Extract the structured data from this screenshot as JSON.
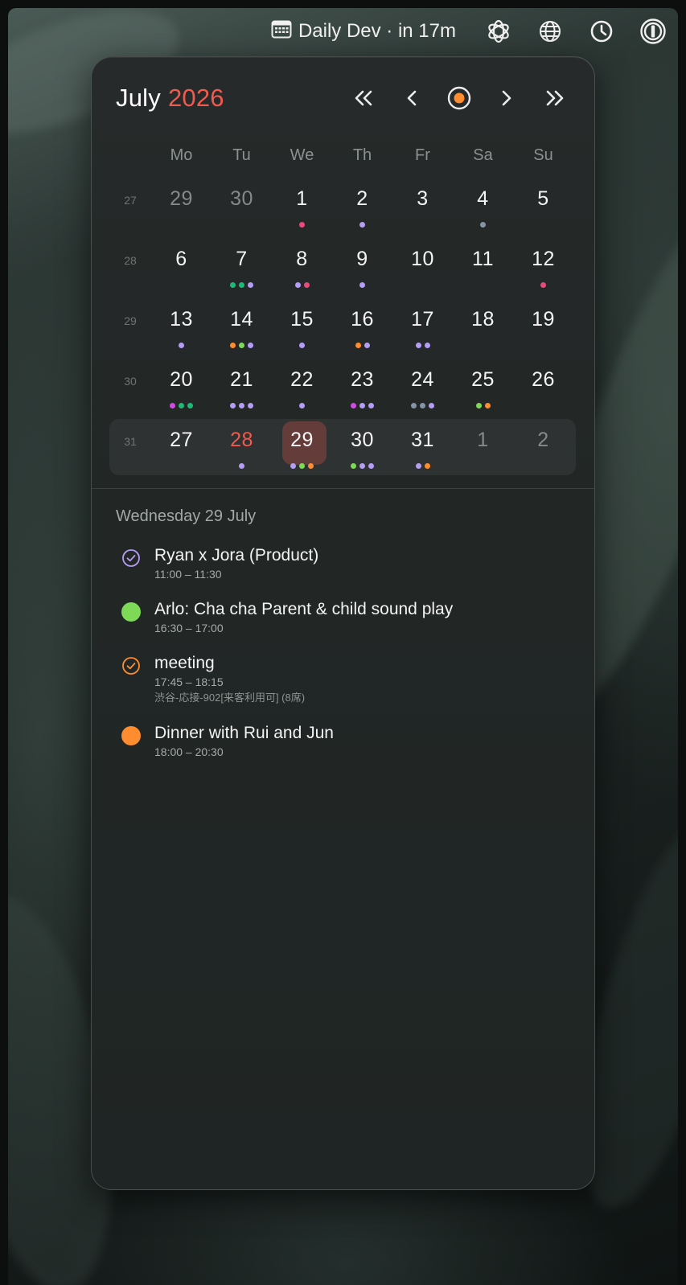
{
  "menubar": {
    "event_label": "Daily Dev · in 17m",
    "icons": [
      "calendar-icon",
      "openai-icon",
      "globe-icon",
      "clock-icon",
      "password-manager-icon"
    ]
  },
  "header": {
    "month": "July",
    "year": "2026",
    "nav": [
      "previous-year",
      "previous-month",
      "today",
      "next-month",
      "next-year"
    ]
  },
  "colors": {
    "accent_red": "#ef5b4f",
    "purple": "#b49cf7",
    "green": "#7ed957",
    "orange": "#ff8c2e",
    "pink": "#e84a7a",
    "teal": "#1fb877",
    "magenta": "#d548e8",
    "slate": "#8493a8"
  },
  "calendar": {
    "weekdays": [
      "Mo",
      "Tu",
      "We",
      "Th",
      "Fr",
      "Sa",
      "Su"
    ],
    "weeks": [
      {
        "week": "27",
        "days": [
          {
            "d": "29",
            "muted": true,
            "dots": []
          },
          {
            "d": "30",
            "muted": true,
            "dots": []
          },
          {
            "d": "1",
            "dots": [
              "pink"
            ]
          },
          {
            "d": "2",
            "dots": [
              "purple"
            ]
          },
          {
            "d": "3",
            "dots": []
          },
          {
            "d": "4",
            "dots": [
              "slate"
            ]
          },
          {
            "d": "5",
            "dots": []
          }
        ]
      },
      {
        "week": "28",
        "days": [
          {
            "d": "6",
            "dots": []
          },
          {
            "d": "7",
            "dots": [
              "teal",
              "teal",
              "purple"
            ]
          },
          {
            "d": "8",
            "dots": [
              "purple",
              "pink"
            ]
          },
          {
            "d": "9",
            "dots": [
              "purple"
            ]
          },
          {
            "d": "10",
            "dots": []
          },
          {
            "d": "11",
            "dots": []
          },
          {
            "d": "12",
            "dots": [
              "pink"
            ]
          }
        ]
      },
      {
        "week": "29",
        "days": [
          {
            "d": "13",
            "dots": [
              "purple"
            ]
          },
          {
            "d": "14",
            "dots": [
              "orange",
              "green",
              "purple"
            ]
          },
          {
            "d": "15",
            "dots": [
              "purple"
            ]
          },
          {
            "d": "16",
            "dots": [
              "orange",
              "purple"
            ]
          },
          {
            "d": "17",
            "dots": [
              "purple",
              "purple"
            ]
          },
          {
            "d": "18",
            "dots": []
          },
          {
            "d": "19",
            "dots": []
          }
        ]
      },
      {
        "week": "30",
        "days": [
          {
            "d": "20",
            "dots": [
              "magenta",
              "teal",
              "teal"
            ]
          },
          {
            "d": "21",
            "dots": [
              "purple",
              "purple",
              "purple"
            ]
          },
          {
            "d": "22",
            "dots": [
              "purple"
            ]
          },
          {
            "d": "23",
            "dots": [
              "magenta",
              "purple",
              "purple"
            ]
          },
          {
            "d": "24",
            "dots": [
              "slate",
              "slate",
              "purple"
            ]
          },
          {
            "d": "25",
            "dots": [
              "green",
              "orange"
            ]
          },
          {
            "d": "26",
            "dots": []
          }
        ]
      },
      {
        "week": "31",
        "current": true,
        "days": [
          {
            "d": "27",
            "dots": []
          },
          {
            "d": "28",
            "today": true,
            "dots": [
              "purple"
            ]
          },
          {
            "d": "29",
            "selected": true,
            "dots": [
              "purple",
              "green",
              "orange"
            ]
          },
          {
            "d": "30",
            "dots": [
              "green",
              "purple",
              "purple"
            ]
          },
          {
            "d": "31",
            "dots": [
              "purple",
              "orange"
            ]
          },
          {
            "d": "1",
            "muted": true,
            "dots": []
          },
          {
            "d": "2",
            "muted": true,
            "dots": []
          }
        ]
      }
    ]
  },
  "agenda": {
    "heading": "Wednesday 29 July",
    "events": [
      {
        "title": "Ryan x Jora (Product)",
        "time": "11:00 – 11:30",
        "location": "",
        "icon": "check-circle-icon",
        "color": "purple",
        "style": "ring-check"
      },
      {
        "title": "Arlo: Cha cha Parent & child sound play",
        "time": "16:30 – 17:00",
        "location": "",
        "icon": "filled-circle-icon",
        "color": "green",
        "style": "filled"
      },
      {
        "title": "meeting",
        "time": "17:45 – 18:15",
        "location": "渋谷-応接-902[来客利用可] (8席)",
        "icon": "check-circle-icon",
        "color": "orange",
        "style": "ring-check"
      },
      {
        "title": "Dinner with Rui and Jun",
        "time": "18:00 – 20:30",
        "location": "",
        "icon": "filled-circle-icon",
        "color": "orange",
        "style": "filled"
      }
    ]
  }
}
